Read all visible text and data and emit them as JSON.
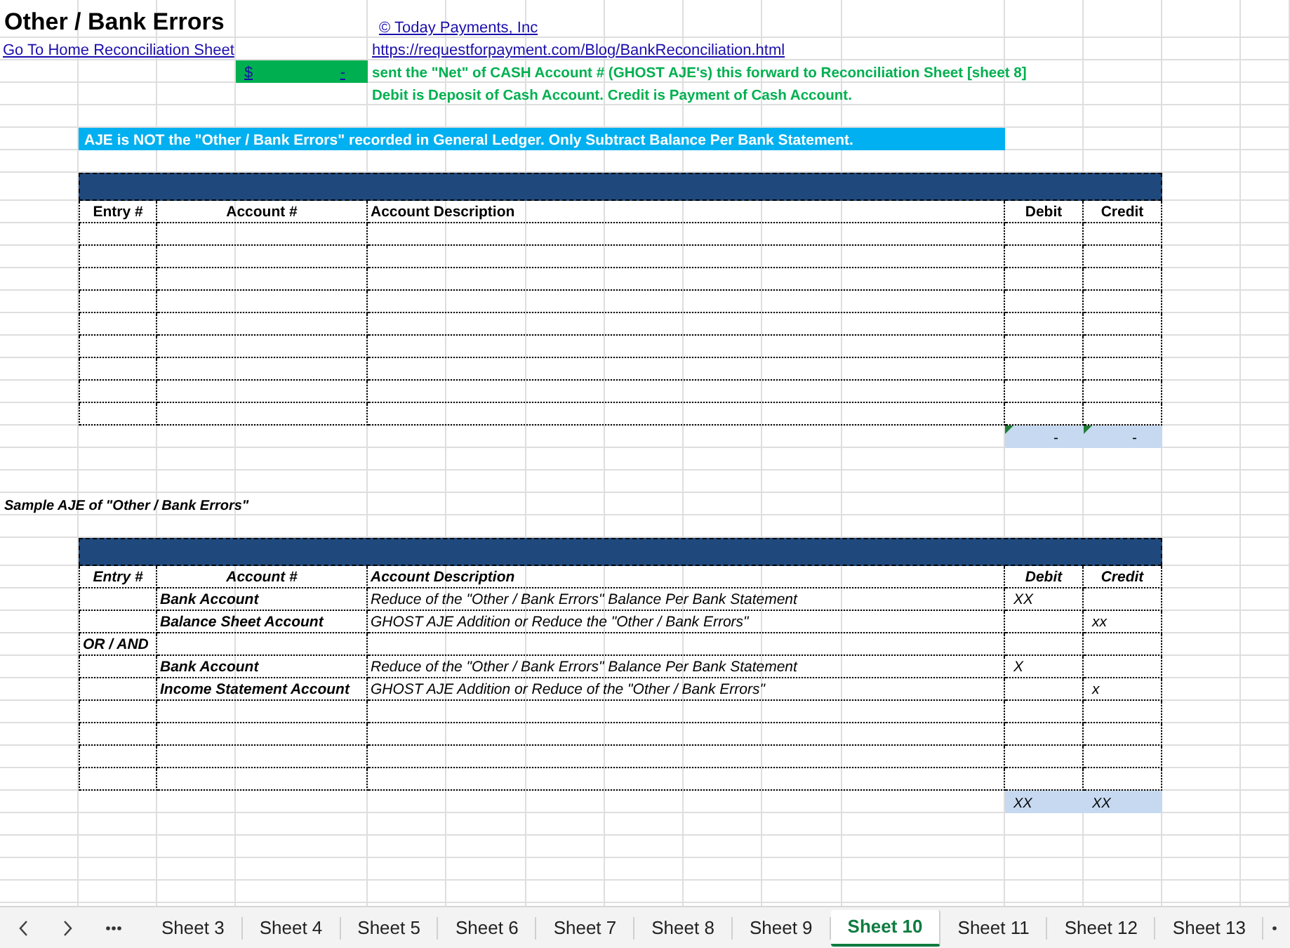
{
  "title": "Other / Bank Errors",
  "copyright_link": "© Today Payments, Inc",
  "home_link": "Go To Home Reconciliation Sheet",
  "url_link": "https://requestforpayment.com/Blog/BankReconciliation.html",
  "net_cell": {
    "currency": "$",
    "amount": "-"
  },
  "notes": [
    "sent the \"Net\" of CASH Account # (GHOST AJE's) this forward to Reconciliation Sheet [sheet 8]",
    "Debit is Deposit of Cash Account.  Credit is Payment of Cash Account."
  ],
  "banner": "AJE is NOT the \"Other / Bank Errors\" recorded in General Ledger.  Only Subtract Balance Per Bank Statement.",
  "journal_table": {
    "columns": [
      "Entry #",
      "Account #",
      "Account Description",
      "Debit",
      "Credit"
    ],
    "totals": [
      {
        "value": "-",
        "flagged": true
      },
      {
        "value": "-",
        "flagged": true
      }
    ]
  },
  "sample_title": "Sample AJE of \"Other / Bank Errors\"",
  "sample_table": {
    "columns": [
      "Entry #",
      "Account #",
      "Account Description",
      "Debit",
      "Credit"
    ],
    "rows": [
      {
        "account": "Bank Account",
        "description": "Reduce of the \"Other / Bank Errors\" Balance Per Bank Statement",
        "debit": "XX"
      },
      {
        "account": "Balance Sheet Account",
        "description": "GHOST AJE Addition or Reduce the \"Other / Bank Errors\"",
        "credit": "xx"
      },
      {
        "entry": "OR / AND"
      },
      {
        "account": "Bank Account",
        "description": "Reduce of the \"Other / Bank Errors\" Balance Per Bank Statement",
        "debit": "X"
      },
      {
        "account": "Income Statement Account",
        "description": "GHOST AJE Addition or Reduce of the \"Other / Bank Errors\"",
        "credit": "x"
      }
    ],
    "totals": [
      {
        "value": "XX",
        "flagged": false
      },
      {
        "value": "XX",
        "flagged": false
      }
    ]
  },
  "sheet_tabs": [
    {
      "label": "Sheet 3",
      "selected": false
    },
    {
      "label": "Sheet 4",
      "selected": false
    },
    {
      "label": "Sheet 5",
      "selected": false
    },
    {
      "label": "Sheet 6",
      "selected": false
    },
    {
      "label": "Sheet 7",
      "selected": false
    },
    {
      "label": "Sheet 8",
      "selected": false
    },
    {
      "label": "Sheet 9",
      "selected": false
    },
    {
      "label": "Sheet 10",
      "selected": true
    },
    {
      "label": "Sheet 11",
      "selected": false
    },
    {
      "label": "Sheet 12",
      "selected": false
    },
    {
      "label": "Sheet 13",
      "selected": false
    }
  ]
}
